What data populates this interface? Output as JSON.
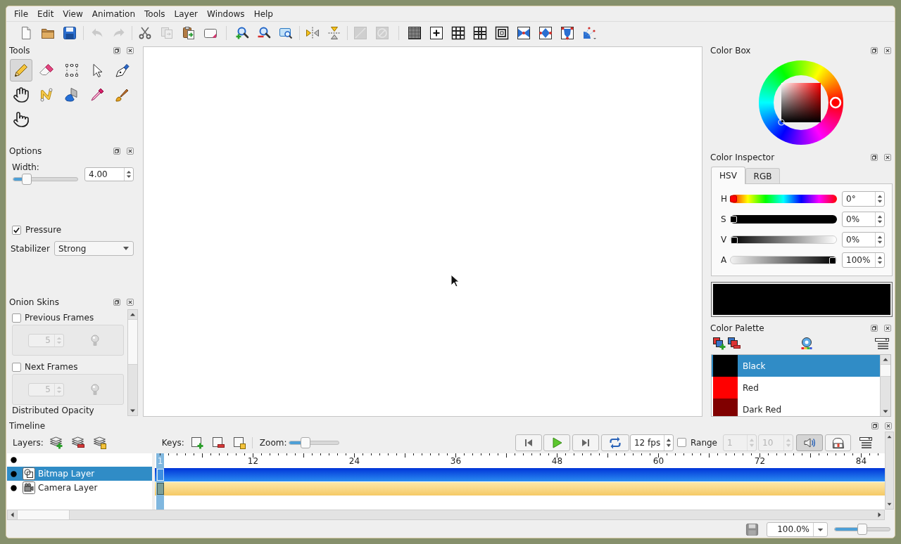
{
  "menu": [
    "File",
    "Edit",
    "View",
    "Animation",
    "Tools",
    "Layer",
    "Windows",
    "Help"
  ],
  "toolbar": [
    {
      "disabled": false
    },
    {
      "disabled": false
    },
    {
      "disabled": false
    },
    {
      "disabled": true
    },
    {
      "disabled": true
    },
    {
      "disabled": false
    },
    {
      "disabled": true
    },
    {
      "disabled": false
    },
    {
      "disabled": false
    },
    {
      "disabled": false
    },
    {
      "disabled": false
    },
    {
      "disabled": false
    },
    {
      "disabled": false
    },
    {
      "disabled": false
    },
    {
      "disabled": true
    },
    {
      "disabled": true
    },
    {
      "disabled": false
    },
    {
      "disabled": false
    },
    {
      "disabled": false
    },
    {
      "disabled": false
    },
    {
      "disabled": false
    },
    {
      "disabled": false
    },
    {
      "disabled": false
    },
    {
      "disabled": false
    },
    {
      "disabled": false
    }
  ],
  "tools_panel": {
    "title": "Tools",
    "tools": [
      {
        "selected": true
      },
      {
        "selected": false
      },
      {
        "selected": false
      },
      {
        "selected": false
      },
      {
        "selected": false
      },
      {
        "selected": false
      },
      {
        "selected": false
      },
      {
        "selected": false
      },
      {
        "selected": false
      },
      {
        "selected": false
      },
      {
        "selected": false
      }
    ]
  },
  "options_panel": {
    "title": "Options",
    "width": {
      "label": "Width:",
      "level": 0.17,
      "value": "4.00"
    },
    "pressure": {
      "label": "Pressure",
      "checked": true
    },
    "stabilizer": {
      "label": "Stabilizer",
      "value": "Strong"
    }
  },
  "onion_skins": {
    "title": "Onion Skins",
    "groups": [
      {
        "label": "Previous Frames",
        "checked": false,
        "count": "5"
      },
      {
        "label": "Next Frames",
        "checked": false,
        "count": "5"
      }
    ],
    "opacity_label": "Distributed Opacity"
  },
  "color_box": {
    "title": "Color Box"
  },
  "color_inspector": {
    "title": "Color Inspector",
    "tabs": [
      {
        "label": "HSV",
        "selected": true
      },
      {
        "label": "RGB",
        "selected": false
      }
    ],
    "channels": [
      {
        "kind": "hue",
        "label": "H",
        "level": 0,
        "value": "0°"
      },
      {
        "kind": "saturation",
        "label": "S",
        "level": 0,
        "value": "0%"
      },
      {
        "kind": "value",
        "label": "V",
        "level": 0,
        "value": "0%"
      },
      {
        "kind": "alpha",
        "label": "A",
        "level": 1,
        "value": "100%"
      }
    ]
  },
  "color_palette": {
    "title": "Color Palette",
    "colors": [
      {
        "name": "Black",
        "color": "#000000",
        "selected": true
      },
      {
        "name": "Red",
        "color": "#ff0000",
        "selected": false
      },
      {
        "name": "Dark Red",
        "color": "#800000",
        "selected": false
      }
    ]
  },
  "timeline": {
    "title": "Timeline",
    "layers_label": "Layers:",
    "keys_label": "Keys:",
    "zoom": {
      "label": "Zoom:",
      "level": 0.28
    },
    "fps": "12 fps",
    "range": {
      "label": "Range",
      "checked": false,
      "start": "1",
      "end": "10"
    },
    "sound": {
      "on": true
    },
    "ruler_labels": [
      "1",
      "12",
      "24",
      "36",
      "48",
      "60",
      "72",
      "84"
    ],
    "layers": [
      {
        "kind": "bitmap",
        "name": "Bitmap Layer",
        "selected": true
      },
      {
        "kind": "camera",
        "name": "Camera Layer",
        "selected": false
      }
    ]
  },
  "status_bar": {
    "zoom": "100.0%",
    "level": 0.5
  }
}
